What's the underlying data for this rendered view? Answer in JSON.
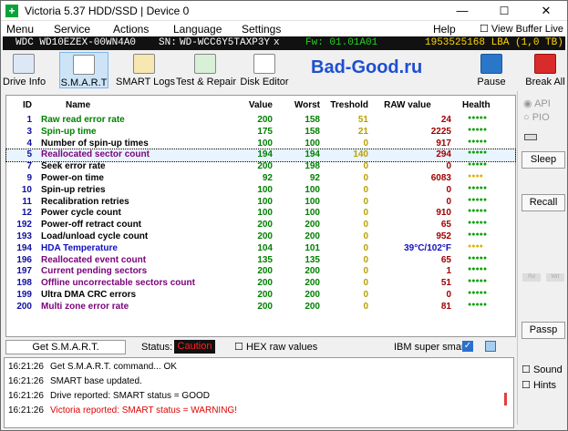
{
  "window": {
    "title": "Victoria 5.37 HDD/SSD | Device 0",
    "min": "—",
    "max": "☐",
    "close": "✕"
  },
  "menu": {
    "items": [
      "Menu",
      "Service",
      "Actions",
      "Language",
      "Settings",
      "Help"
    ],
    "view_buffer": "View Buffer Live"
  },
  "device": {
    "model": "WDC WD10EZEX-00WN4A0",
    "sn_label": "SN:",
    "sn": "WD-WCC6Y5TAXP3Y",
    "close": "x",
    "fw": "Fw: 01.01A01",
    "lba": "1953525168 LBA (1,0 TB)"
  },
  "toolbar": {
    "drive_info": "Drive Info",
    "smart": "S.M.A.R.T",
    "smart_logs": "SMART Logs",
    "test_repair": "Test & Repair",
    "disk_editor": "Disk Editor",
    "brand": "Bad-Good.ru",
    "pause": "Pause",
    "break_all": "Break All"
  },
  "table": {
    "headers": {
      "id": "ID",
      "name": "Name",
      "value": "Value",
      "worst": "Worst",
      "threshold": "Treshold",
      "raw": "RAW value",
      "health": "Health"
    },
    "rows": [
      {
        "id": "1",
        "name": "Raw read error rate",
        "value": "200",
        "worst": "158",
        "th": "51",
        "raw": "24",
        "health": "●●●●●",
        "nc": "#008000"
      },
      {
        "id": "3",
        "name": "Spin-up time",
        "value": "175",
        "worst": "158",
        "th": "21",
        "raw": "2225",
        "health": "●●●●●",
        "nc": "#008000"
      },
      {
        "id": "4",
        "name": "Number of spin-up times",
        "value": "100",
        "worst": "100",
        "th": "0",
        "raw": "917",
        "health": "●●●●●",
        "nc": "#000000"
      },
      {
        "id": "5",
        "name": "Reallocated sector count",
        "value": "194",
        "worst": "194",
        "th": "140",
        "raw": "294",
        "health": "●●●●●",
        "nc": "#7a007a"
      },
      {
        "id": "7",
        "name": "Seek error rate",
        "value": "200",
        "worst": "198",
        "th": "0",
        "raw": "0",
        "health": "●●●●●",
        "nc": "#000000"
      },
      {
        "id": "9",
        "name": "Power-on time",
        "value": "92",
        "worst": "92",
        "th": "0",
        "raw": "6083",
        "health": "●●●●",
        "nc": "#000000"
      },
      {
        "id": "10",
        "name": "Spin-up retries",
        "value": "100",
        "worst": "100",
        "th": "0",
        "raw": "0",
        "health": "●●●●●",
        "nc": "#000000"
      },
      {
        "id": "11",
        "name": "Recalibration retries",
        "value": "100",
        "worst": "100",
        "th": "0",
        "raw": "0",
        "health": "●●●●●",
        "nc": "#000000"
      },
      {
        "id": "12",
        "name": "Power cycle count",
        "value": "100",
        "worst": "100",
        "th": "0",
        "raw": "910",
        "health": "●●●●●",
        "nc": "#000000"
      },
      {
        "id": "192",
        "name": "Power-off retract count",
        "value": "200",
        "worst": "200",
        "th": "0",
        "raw": "65",
        "health": "●●●●●",
        "nc": "#000000"
      },
      {
        "id": "193",
        "name": "Load/unload cycle count",
        "value": "200",
        "worst": "200",
        "th": "0",
        "raw": "952",
        "health": "●●●●●",
        "nc": "#000000"
      },
      {
        "id": "194",
        "name": "HDA Temperature",
        "value": "104",
        "worst": "101",
        "th": "0",
        "raw": "39°C/102°F",
        "health": "●●●●",
        "nc": "#1010c0"
      },
      {
        "id": "196",
        "name": "Reallocated event count",
        "value": "135",
        "worst": "135",
        "th": "0",
        "raw": "65",
        "health": "●●●●●",
        "nc": "#7a007a"
      },
      {
        "id": "197",
        "name": "Current pending sectors",
        "value": "200",
        "worst": "200",
        "th": "0",
        "raw": "1",
        "health": "●●●●●",
        "nc": "#7a007a"
      },
      {
        "id": "198",
        "name": "Offline uncorrectable sectors count",
        "value": "200",
        "worst": "200",
        "th": "0",
        "raw": "51",
        "health": "●●●●●",
        "nc": "#7a007a"
      },
      {
        "id": "199",
        "name": "Ultra DMA CRC errors",
        "value": "200",
        "worst": "200",
        "th": "0",
        "raw": "0",
        "health": "●●●●●",
        "nc": "#000000"
      },
      {
        "id": "200",
        "name": "Multi zone error rate",
        "value": "200",
        "worst": "200",
        "th": "0",
        "raw": "81",
        "health": "●●●●●",
        "nc": "#7a007a"
      }
    ]
  },
  "status": {
    "get_smart": "Get S.M.A.R.T.",
    "status_label": "Status:",
    "status_value": "Caution",
    "hex_label": "HEX raw values",
    "ibm_label": "IBM super smart:"
  },
  "sidebar": {
    "api": "API",
    "pio": "PIO",
    "sleep": "Sleep",
    "recall": "Recall",
    "rd": "Rd",
    "wrt": "Wrt",
    "passp": "Passp",
    "sound": "Sound",
    "hints": "Hints"
  },
  "log": [
    {
      "time": "16:21:26",
      "text": "Get S.M.A.R.T. command... OK",
      "color": "#000000"
    },
    {
      "time": "16:21:26",
      "text": "SMART base updated.",
      "color": "#000000"
    },
    {
      "time": "16:21:26",
      "text": "Drive reported: SMART status = GOOD",
      "color": "#000000"
    },
    {
      "time": "16:21:26",
      "text": "Victoria reported: SMART status = WARNING!",
      "color": "#e00000"
    }
  ],
  "colors": {
    "value": "#008000",
    "worst": "#008000",
    "threshold": "#b8a000",
    "raw": "#a00000",
    "health_good": "#00a000",
    "health_warn": "#e0b000",
    "lba": "#ffd800",
    "fw": "#22d322",
    "device": "#ffffff"
  }
}
